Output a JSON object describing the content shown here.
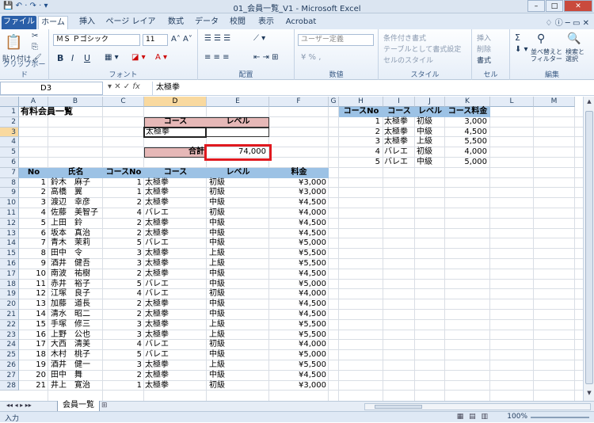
{
  "window": {
    "title": "01_会員一覧_V1 - Microsoft Excel",
    "quick_access": "💾 ↶ · ↷ · ▾"
  },
  "tabs": [
    "ファイル",
    "ホーム",
    "挿入",
    "ページ レイアウト",
    "数式",
    "データ",
    "校閲",
    "表示",
    "Acrobat"
  ],
  "ribbon": {
    "clipboard": {
      "label": "クリップボード",
      "paste": "貼り付け"
    },
    "font": {
      "label": "フォント",
      "name": "ＭＳ Ｐゴシック",
      "size": "11",
      "bold": "B",
      "italic": "I",
      "underline": "U"
    },
    "alignment": {
      "label": "配置"
    },
    "number": {
      "label": "数値",
      "format": "ユーザー定義"
    },
    "styles": {
      "label": "スタイル",
      "conditional": "条件付き書式",
      "table": "テーブルとして書式設定",
      "cell_styles": "セルのスタイル"
    },
    "cells": {
      "label": "セル",
      "insert": "挿入",
      "delete": "削除",
      "format": "書式"
    },
    "editing": {
      "label": "編集",
      "sum": "Σ",
      "sort": "並べ替えと フィルター",
      "find": "検索と 選択"
    }
  },
  "formula_bar": {
    "name_box": "D3",
    "fx": "fx",
    "value": "太極拳"
  },
  "columns": [
    "A",
    "B",
    "C",
    "D",
    "E",
    "F",
    "G",
    "H",
    "I",
    "J",
    "K",
    "L",
    "M"
  ],
  "rows": [
    "1",
    "2",
    "3",
    "4",
    "5",
    "6",
    "7",
    "8",
    "9",
    "10",
    "11",
    "12",
    "13",
    "14",
    "15",
    "16",
    "17",
    "18",
    "19",
    "20",
    "21",
    "22",
    "23",
    "24",
    "25",
    "26",
    "27",
    "28"
  ],
  "sheet": {
    "title": "有料会員一覧",
    "lookup": {
      "course_hdr": "コース",
      "level_hdr": "レベル",
      "course_val": "太極拳",
      "level_val": "",
      "total_label": "合計",
      "total_val": "74,000"
    },
    "headers": [
      "No",
      "氏名",
      "コースNo",
      "コース",
      "レベル",
      "料金"
    ],
    "members": [
      [
        "1",
        "鈴木　麻子",
        "1",
        "太極拳",
        "初級",
        "¥3,000"
      ],
      [
        "2",
        "高橋　翼",
        "1",
        "太極拳",
        "初級",
        "¥3,000"
      ],
      [
        "3",
        "渡辺　幸彦",
        "2",
        "太極拳",
        "中級",
        "¥4,500"
      ],
      [
        "4",
        "佐藤　美智子",
        "4",
        "バレエ",
        "初級",
        "¥4,000"
      ],
      [
        "5",
        "上田　鈴",
        "2",
        "太極拳",
        "中級",
        "¥4,500"
      ],
      [
        "6",
        "坂本　真治",
        "2",
        "太極拳",
        "中級",
        "¥4,500"
      ],
      [
        "7",
        "青木　茉莉",
        "5",
        "バレエ",
        "中級",
        "¥5,000"
      ],
      [
        "8",
        "田中　令",
        "3",
        "太極拳",
        "上級",
        "¥5,500"
      ],
      [
        "9",
        "酒井　健吾",
        "3",
        "太極拳",
        "上級",
        "¥5,500"
      ],
      [
        "10",
        "南波　祐樹",
        "2",
        "太極拳",
        "中級",
        "¥4,500"
      ],
      [
        "11",
        "赤井　裕子",
        "5",
        "バレエ",
        "中級",
        "¥5,000"
      ],
      [
        "12",
        "江塚　良子",
        "4",
        "バレエ",
        "初級",
        "¥4,000"
      ],
      [
        "13",
        "加藤　道長",
        "2",
        "太極拳",
        "中級",
        "¥4,500"
      ],
      [
        "14",
        "清水　昭二",
        "2",
        "太極拳",
        "中級",
        "¥4,500"
      ],
      [
        "15",
        "手塚　修三",
        "3",
        "太極拳",
        "上級",
        "¥5,500"
      ],
      [
        "16",
        "上野　公也",
        "3",
        "太極拳",
        "上級",
        "¥5,500"
      ],
      [
        "17",
        "大西　清美",
        "4",
        "バレエ",
        "初級",
        "¥4,000"
      ],
      [
        "18",
        "木村　桃子",
        "5",
        "バレエ",
        "中級",
        "¥5,000"
      ],
      [
        "19",
        "酒井　健一",
        "3",
        "太極拳",
        "上級",
        "¥5,500"
      ],
      [
        "20",
        "田中　舞",
        "2",
        "太極拳",
        "中級",
        "¥4,500"
      ],
      [
        "21",
        "井上　寛治",
        "1",
        "太極拳",
        "初級",
        "¥3,000"
      ]
    ],
    "course_table": {
      "headers": [
        "コースNo",
        "コース",
        "レベル",
        "コース料金"
      ],
      "rows": [
        [
          "1",
          "太極拳",
          "初級",
          "3,000"
        ],
        [
          "2",
          "太極拳",
          "中級",
          "4,500"
        ],
        [
          "3",
          "太極拳",
          "上級",
          "5,500"
        ],
        [
          "4",
          "バレエ",
          "初級",
          "4,000"
        ],
        [
          "5",
          "バレエ",
          "中級",
          "5,000"
        ]
      ]
    }
  },
  "sheet_tabs": {
    "active": "会員一覧"
  },
  "status": {
    "mode": "入力",
    "zoom": "100%"
  }
}
